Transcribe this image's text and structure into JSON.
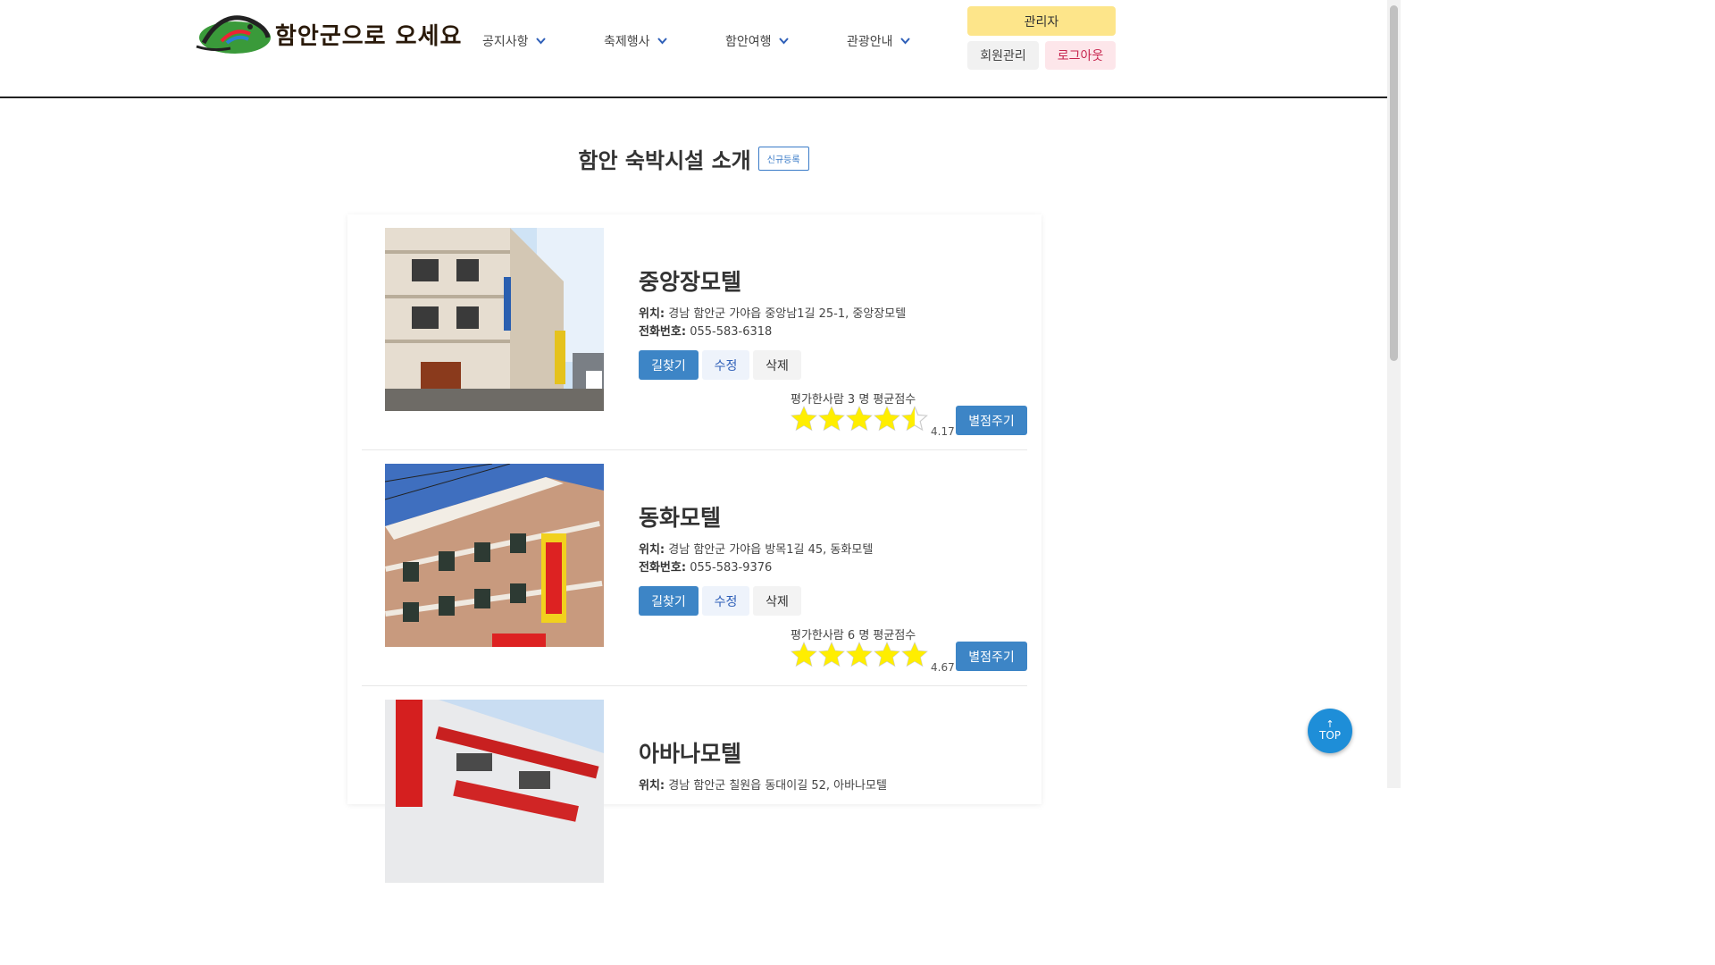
{
  "header": {
    "logo_text": "함안군으로 오세요",
    "nav": [
      {
        "label": "공지사항"
      },
      {
        "label": "축제행사"
      },
      {
        "label": "함안여행"
      },
      {
        "label": "관광안내"
      }
    ],
    "admin_label": "관리자",
    "member_label": "회원관리",
    "logout_label": "로그아웃"
  },
  "page": {
    "title": "함안 숙박시설 소개",
    "new_label": "신규등록"
  },
  "labels": {
    "location": "위치:",
    "phone": "전화번호:",
    "route": "길찾기",
    "edit": "수정",
    "delete": "삭제",
    "rate": "별점주기"
  },
  "items": [
    {
      "name": "중앙장모텔",
      "location": "경남 함안군 가야읍 중앙남1길 25-1, 중앙장모텔",
      "phone": "055-583-6318",
      "rating_text": "평가한사람 3 명 평균점수",
      "score": "4.17",
      "stars": 4.5
    },
    {
      "name": "동화모텔",
      "location": "경남 함안군 가야읍 방목1길 45, 동화모텔",
      "phone": "055-583-9376",
      "rating_text": "평가한사람 6 명 평균점수",
      "score": "4.67",
      "stars": 5
    },
    {
      "name": "아바나모텔",
      "location": "경남 함안군 칠원읍 동대이길 52, 아바나모텔"
    }
  ],
  "top_button": "TOP",
  "colors": {
    "primary_button": "#3d85c6",
    "admin_bg": "#fde58a",
    "logout_text": "#c7254e",
    "star": "#ffee00",
    "top_button": "#1e8ed8"
  }
}
